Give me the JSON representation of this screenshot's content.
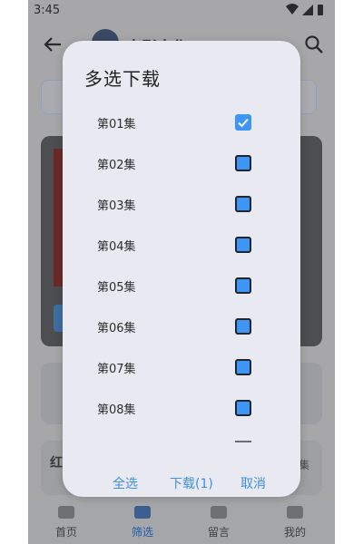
{
  "status_bar": {
    "time": "3:45"
  },
  "app_bar": {
    "title": "电影大作"
  },
  "background": {
    "side_left": "红",
    "side_right": "集"
  },
  "bottom_nav": {
    "items": [
      {
        "label": "首页",
        "active": false
      },
      {
        "label": "筛选",
        "active": true
      },
      {
        "label": "留言",
        "active": false
      },
      {
        "label": "我的",
        "active": false
      }
    ]
  },
  "dialog": {
    "title": "多选下载",
    "episodes": [
      {
        "label": "第01集",
        "checked": true
      },
      {
        "label": "第02集",
        "checked": false
      },
      {
        "label": "第03集",
        "checked": false
      },
      {
        "label": "第04集",
        "checked": false
      },
      {
        "label": "第05集",
        "checked": false
      },
      {
        "label": "第06集",
        "checked": false
      },
      {
        "label": "第07集",
        "checked": false
      },
      {
        "label": "第08集",
        "checked": false
      }
    ],
    "actions": {
      "select_all": "全选",
      "download": "下载(1)",
      "cancel": "取消"
    }
  },
  "colors": {
    "accent": "#3d8ee6",
    "checkbox": "#3d95f5",
    "dialog_bg": "#e9eaf1",
    "scrim": "#a7a7aa"
  }
}
